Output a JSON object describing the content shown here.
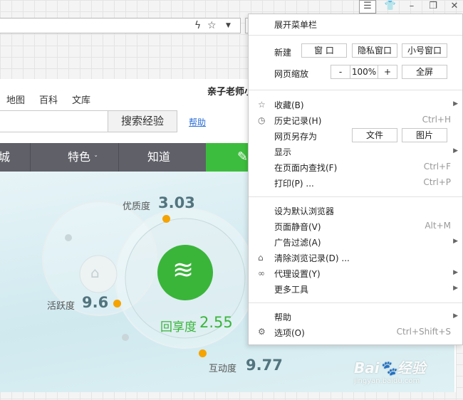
{
  "window_controls": {
    "menu_icon": "hamburger-menu-icon",
    "skin_icon": "tshirt-skin-icon",
    "minimize_icon": "minimize-icon",
    "restore_icon": "restore-icon",
    "close_icon": "close-icon"
  },
  "address_bar": {
    "icons": [
      "lightning-icon",
      "star-icon",
      "dropdown-arrow-icon"
    ]
  },
  "page": {
    "top_links": [
      "地图",
      "百科",
      "文库"
    ],
    "user_text": "亲子老师小",
    "search_button": "搜索经验",
    "help_link": "帮助",
    "nav": {
      "left_partial": "城",
      "special": "特色",
      "know": "知道",
      "green_partial": "i"
    },
    "stats": {
      "quality_label": "优质度",
      "quality_value": "3.03",
      "activity_label": "活跃度",
      "activity_value": "9.6",
      "share_label": "回享度",
      "share_value": "2.55",
      "interaction_label": "互动度",
      "interaction_value": "9.77"
    }
  },
  "menu": {
    "expand_menubar": "展开菜单栏",
    "new_label": "新建",
    "new_window": "窗 口",
    "private_window": "隐私窗口",
    "small_window": "小号窗口",
    "zoom_label": "网页缩放",
    "zoom_minus": "-",
    "zoom_value": "100%",
    "zoom_plus": "+",
    "fullscreen": "全屏",
    "favorites": "收藏(B)",
    "history": "历史记录(H)",
    "history_shortcut": "Ctrl+H",
    "save_as": "网页另存为",
    "save_file": "文件",
    "save_image": "图片",
    "display": "显示",
    "find": "在页面内查找(F)",
    "find_shortcut": "Ctrl+F",
    "print": "打印(P) ...",
    "print_shortcut": "Ctrl+P",
    "set_default": "设为默认浏览器",
    "mute": "页面静音(V)",
    "mute_shortcut": "Alt+M",
    "adblock": "广告过滤(A)",
    "clear_history": "清除浏览记录(D) ...",
    "proxy": "代理设置(Y)",
    "more_tools": "更多工具",
    "help": "帮助",
    "options": "选项(O)",
    "options_shortcut": "Ctrl+Shift+S"
  },
  "watermark": {
    "brand": "Bai",
    "brand2": "经验",
    "url": "jingyan.baidu.com"
  }
}
